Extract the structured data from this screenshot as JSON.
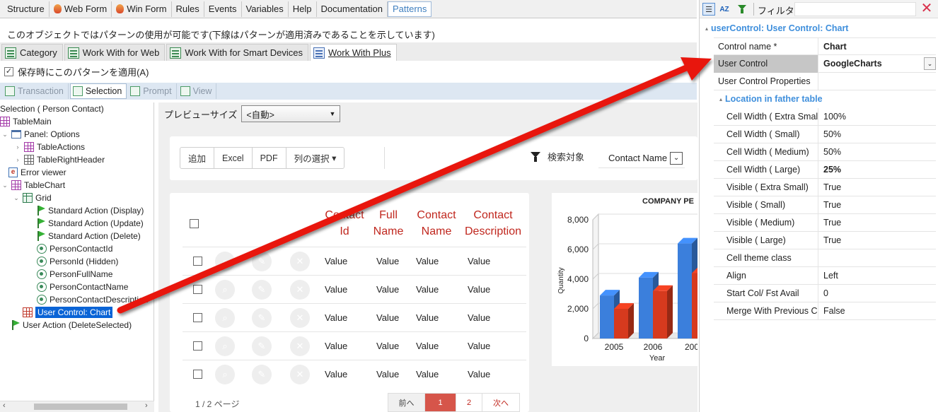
{
  "top_tabs": [
    {
      "label": "Structure",
      "icon": "none"
    },
    {
      "label": "Web Form",
      "icon": "flame-icon"
    },
    {
      "label": "Win Form",
      "icon": "flame-icon"
    },
    {
      "label": "Rules",
      "icon": "none"
    },
    {
      "label": "Events",
      "icon": "none"
    },
    {
      "label": "Variables",
      "icon": "none"
    },
    {
      "label": "Help",
      "icon": "none"
    },
    {
      "label": "Documentation",
      "icon": "none"
    },
    {
      "label": "Patterns",
      "icon": "none",
      "active": true
    }
  ],
  "info_text": "このオブジェクトではパターンの使用が可能です(下線はパターンが適用済みであることを示しています)",
  "pattern_tabs": [
    {
      "label": "Category"
    },
    {
      "label": "Work With for Web"
    },
    {
      "label": "Work With for Smart Devices"
    },
    {
      "label": "Work With Plus",
      "active": true
    }
  ],
  "apply_on_save": {
    "checked": true,
    "label": "保存時にこのパターンを適用(A)",
    "check_glyph": "✓"
  },
  "sub_tabs": [
    {
      "label": "Transaction"
    },
    {
      "label": "Selection",
      "active": true
    },
    {
      "label": "Prompt"
    },
    {
      "label": "View"
    }
  ],
  "tree": {
    "nodes": [
      {
        "label": "Selection ( Person Contact)"
      },
      {
        "label": "TableMain"
      },
      {
        "label": "Panel: Options"
      },
      {
        "label": "TableActions"
      },
      {
        "label": "TableRightHeader"
      },
      {
        "label": "Error viewer"
      },
      {
        "label": "TableChart"
      },
      {
        "label": "Grid"
      },
      {
        "label": "Standard Action (Display)"
      },
      {
        "label": "Standard Action (Update)"
      },
      {
        "label": "Standard Action (Delete)"
      },
      {
        "label": "PersonContactId"
      },
      {
        "label": "PersonId (Hidden)"
      },
      {
        "label": "PersonFullName"
      },
      {
        "label": "PersonContactName"
      },
      {
        "label": "PersonContactDescription"
      },
      {
        "label": "User Control: Chart",
        "selected": true
      },
      {
        "label": "User Action (DeleteSelected)"
      }
    ],
    "scroll_left": "‹",
    "scroll_right": "›"
  },
  "preview": {
    "size_label": "プレビューサイズ",
    "size_value": "<自動>",
    "toolbar_buttons": [
      "追加",
      "Excel",
      "PDF",
      "列の選択"
    ],
    "dropdown_caret": "▾",
    "filter_label": "検索対象",
    "filter_field": "Contact Name",
    "grid": {
      "headers": [
        [
          "Contact",
          "Id"
        ],
        [
          "Full",
          "Name"
        ],
        [
          "Contact",
          "Name"
        ],
        [
          "Contact",
          "Description"
        ]
      ],
      "rows": [
        [
          "Value",
          "Value",
          "Value",
          "Value"
        ],
        [
          "Value",
          "Value",
          "Value",
          "Value"
        ],
        [
          "Value",
          "Value",
          "Value",
          "Value"
        ],
        [
          "Value",
          "Value",
          "Value",
          "Value"
        ],
        [
          "Value",
          "Value",
          "Value",
          "Value"
        ]
      ],
      "row_action_icons": [
        "search-icon",
        "pencil-icon",
        "close-icon"
      ]
    },
    "pager": {
      "page_info": "1 / 2 ページ",
      "prev": "前へ",
      "pages": [
        "1",
        "2"
      ],
      "current": "1",
      "next": "次へ"
    }
  },
  "chart_data": {
    "type": "bar",
    "title": "COMPANY PE",
    "xlabel": "Year",
    "ylabel": "Quantity",
    "categories": [
      "2005",
      "2006",
      "200"
    ],
    "series": [
      {
        "color": "#3b7fdc",
        "values": [
          2900,
          4100,
          6400
        ]
      },
      {
        "color": "#d63a1e",
        "values": [
          2000,
          3200,
          4400
        ]
      }
    ],
    "ylim": [
      0,
      8000
    ],
    "yticks": [
      "0",
      "2,000",
      "4,000",
      "6,000",
      "8,000"
    ],
    "yticks_values": [
      0,
      2000,
      4000,
      6000,
      8000
    ],
    "grid": true,
    "legend": "none",
    "truncated_at_right": true
  },
  "properties": {
    "toolbar": {
      "sort_category_icon": "category-sort-icon",
      "sort_alpha_icon": "az-sort-icon",
      "sort_alpha_text": "AZ",
      "filter_icon": "filter-icon",
      "filter_label": "フィルタ",
      "filter_value": "",
      "close_glyph": "✕"
    },
    "header": "userControl: User Control: Chart",
    "rows": [
      {
        "name": "Control name *",
        "value": "Chart",
        "bold": true
      },
      {
        "name": "User Control",
        "value": "GoogleCharts",
        "bold": true,
        "dropdown": true,
        "highlight": true
      },
      {
        "name": "User Control Properties",
        "value": ""
      }
    ],
    "subcategory": "Location in father table",
    "sub_rows": [
      {
        "name": "Cell Width ( Extra Small)",
        "value": "100%"
      },
      {
        "name": "Cell Width ( Small)",
        "value": "50%"
      },
      {
        "name": "Cell Width ( Medium)",
        "value": "50%"
      },
      {
        "name": "Cell Width ( Large)",
        "value": "25%",
        "bold": true
      },
      {
        "name": "Visible ( Extra Small)",
        "value": "True"
      },
      {
        "name": "Visible ( Small)",
        "value": "True"
      },
      {
        "name": "Visible ( Medium)",
        "value": "True"
      },
      {
        "name": "Visible ( Large)",
        "value": "True"
      },
      {
        "name": "Cell theme class",
        "value": ""
      },
      {
        "name": "Align",
        "value": "Left"
      },
      {
        "name": "Start Col/ Fst Avail",
        "value": "0"
      },
      {
        "name": "Merge With Previous Cell",
        "value": "False"
      }
    ],
    "collapse_glyph": "▴"
  },
  "annotation": {
    "arrow_color": "#e8120c"
  }
}
